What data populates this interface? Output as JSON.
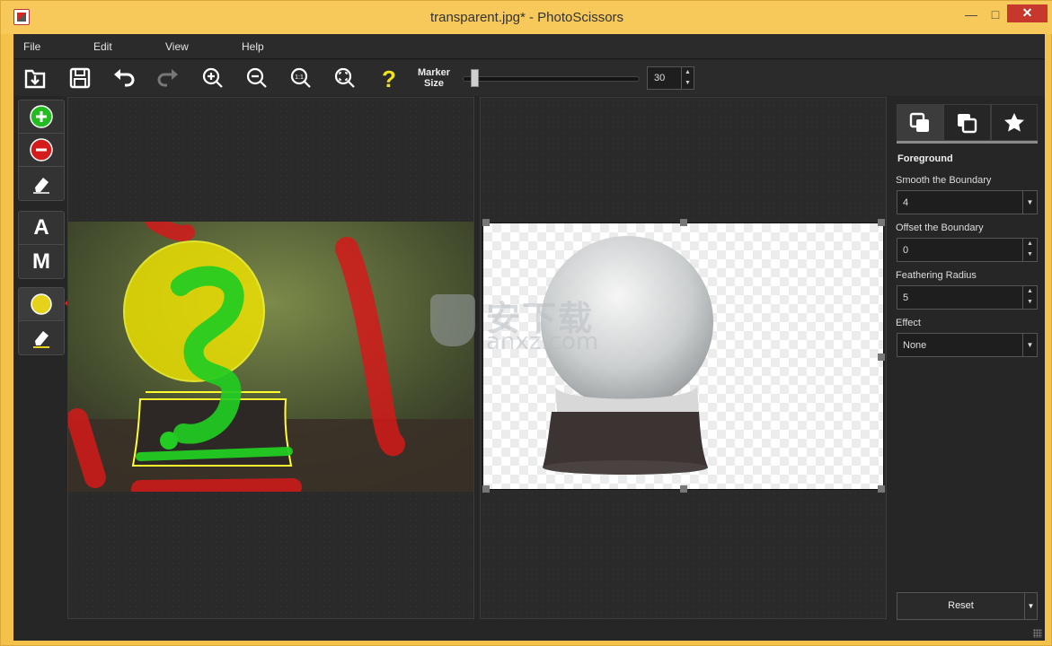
{
  "window": {
    "title": "transparent.jpg* - PhotoScissors"
  },
  "menu": {
    "items": [
      "File",
      "Edit",
      "View",
      "Help"
    ]
  },
  "toolbar": {
    "buttons": [
      "open-icon",
      "save-icon",
      "undo-icon",
      "redo-icon",
      "zoom-in-icon",
      "zoom-out-icon",
      "actual-size-icon",
      "fit-icon",
      "help-icon"
    ],
    "marker_label_1": "Marker",
    "marker_label_2": "Size",
    "marker_size": "30",
    "marker_fraction": 0.05
  },
  "palette": {
    "group1": [
      "foreground-marker-icon",
      "background-marker-icon",
      "eraser-icon"
    ],
    "auto_label": "A",
    "manual_label": "M",
    "group3": [
      "hair-marker-icon",
      "hair-eraser-icon"
    ]
  },
  "colors": {
    "foreground_marker": "#22cc22",
    "background_marker": "#d91c1c",
    "hair_marker": "#e6d21a",
    "annotation_arrow": "#e02020"
  },
  "watermark": {
    "cn": "安下载",
    "en": "anxz.com"
  },
  "sidebar": {
    "tabs": [
      "foreground-tab-icon",
      "background-tab-icon",
      "effects-tab-icon"
    ],
    "section_title": "Foreground",
    "smooth_label": "Smooth the Boundary",
    "smooth_value": "4",
    "offset_label": "Offset the Boundary",
    "offset_value": "0",
    "feather_label": "Feathering Radius",
    "feather_value": "5",
    "effect_label": "Effect",
    "effect_value": "None",
    "reset_label": "Reset"
  }
}
